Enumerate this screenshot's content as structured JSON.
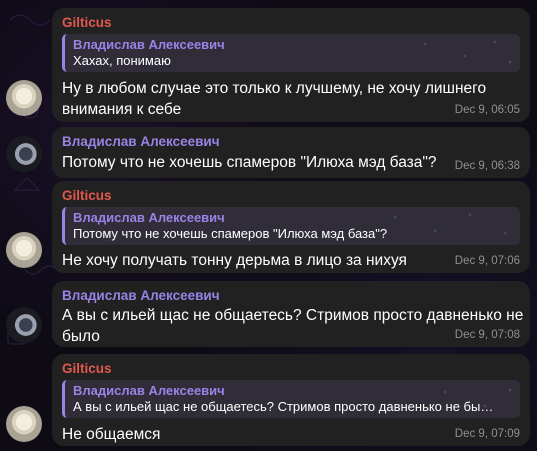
{
  "colors": {
    "background": "#0e0b15",
    "bubble": "#212121",
    "sender_gilticus": "#e1584f",
    "sender_vladislav": "#9a83e6",
    "timestamp": "#8f8f96"
  },
  "messages": [
    {
      "sender": "Gilticus",
      "reply": {
        "name": "Владислав Алексеевич",
        "text": "Хахах, понимаю"
      },
      "text": "Ну в любом случае это только к лучшему, не хочу лишнего внимания к себе",
      "time": "Dec 9, 06:05",
      "avatar": "gilticus-avatar"
    },
    {
      "sender": "Владислав Алексеевич",
      "text": "Потому что не хочешь спамеров \"Илюха мэд база\"?",
      "time": "Dec 9, 06:38",
      "avatar": "vladislav-avatar"
    },
    {
      "sender": "Gilticus",
      "reply": {
        "name": "Владислав Алексеевич",
        "text": "Потому что не хочешь спамеров \"Илюха мэд база\"?"
      },
      "text": "Не хочу получать тонну дерьма в лицо за нихуя",
      "time": "Dec 9, 07:06",
      "avatar": "gilticus-avatar"
    },
    {
      "sender": "Владислав Алексеевич",
      "text": "А вы с ильей щас не общаетесь? Стримов просто давненько не было",
      "time": "Dec 9, 07:08",
      "avatar": "vladislav-avatar"
    },
    {
      "sender": "Gilticus",
      "reply": {
        "name": "Владислав Алексеевич",
        "text": "А вы с ильей щас не общаетесь? Стримов просто давненько не бы…"
      },
      "text": "Не общаемся",
      "time": "Dec 9, 07:09",
      "avatar": "gilticus-avatar"
    }
  ]
}
